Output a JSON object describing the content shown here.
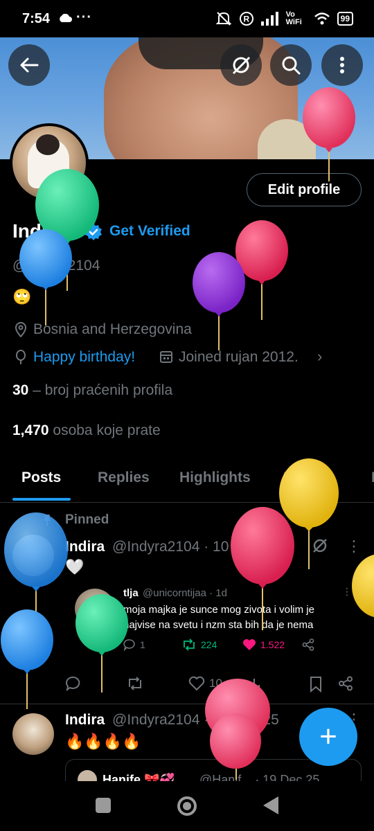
{
  "status_bar": {
    "time": "7:54",
    "more": "···",
    "network": "Vo WiFi",
    "battery": "99"
  },
  "header": {
    "back_icon": "arrow-left-icon",
    "grok_icon": "grok-icon",
    "search_icon": "search-icon",
    "more_icon": "more-vertical-icon"
  },
  "profile": {
    "edit_label": "Edit profile",
    "name": "Indira",
    "get_verified": "Get Verified",
    "handle": "@Indyra2104",
    "bio_emoji": "🙄",
    "location": "Bosnia and Herzegovina",
    "birthday": "Happy birthday!",
    "joined": "Joined rujan 2012.",
    "following_count": "30",
    "following_label": " – broj praćenih profila",
    "followers_count": "1,470",
    "followers_label": " osoba koje prate"
  },
  "tabs": [
    "Posts",
    "Replies",
    "Highlights",
    "Articles",
    "M"
  ],
  "posts": [
    {
      "pinned_label": "Pinned",
      "name": "Indira",
      "meta": "@Indyra2104 · 10 May 22",
      "text": "🤍",
      "quote": {
        "name": "tlja",
        "meta": "@unicorntijaa · 1d",
        "text": "moja majka je sunce mog zivota i volim je najvise na svetu i nzm sta bih da je nema",
        "replies": "1",
        "reposts": "224",
        "likes": "1.522"
      },
      "likes": "10"
    },
    {
      "name": "Indira",
      "meta": "@Indyra2104 · 19 Dec 25",
      "text": "🔥🔥🔥🔥",
      "quote": {
        "name": "Hanife 🎀💞",
        "meta": "@Hanif... · 19 Dec 25"
      }
    }
  ],
  "fab_label": "+",
  "colors": {
    "accent": "#1d9bf0",
    "background": "#000000",
    "muted": "#71767b",
    "like": "#f91880",
    "repost": "#00ba7c"
  }
}
